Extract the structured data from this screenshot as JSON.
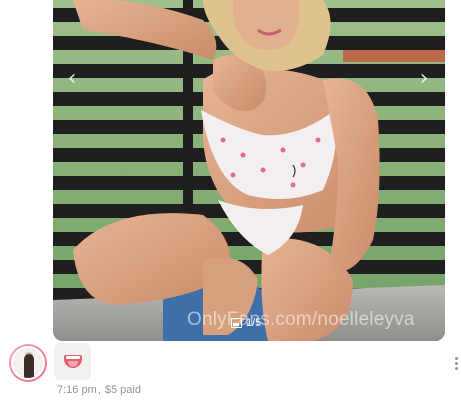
{
  "media": {
    "counter": "1/5",
    "watermark": "OnlyFans.com/noelleleyva",
    "icons": {
      "prev": "chevron-left-icon",
      "next": "chevron-right-icon",
      "counter": "gallery-icon"
    }
  },
  "message": {
    "time": "7:16 pm",
    "price": "$5 paid",
    "reaction": "tongue-emoji-icon",
    "more": "more-vertical-icon"
  }
}
